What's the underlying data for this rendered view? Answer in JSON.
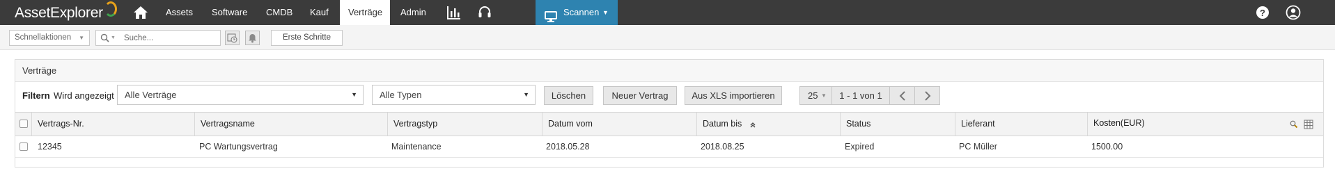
{
  "app": {
    "logo_text": "AssetExplorer"
  },
  "nav": {
    "items": [
      {
        "label": "Assets"
      },
      {
        "label": "Software"
      },
      {
        "label": "CMDB"
      },
      {
        "label": "Kauf"
      },
      {
        "label": "Verträge"
      },
      {
        "label": "Admin"
      }
    ],
    "active": "Verträge",
    "scan_label": "Scannen"
  },
  "quickbar": {
    "quick_actions_label": "Schnellaktionen",
    "search_placeholder": "Suche...",
    "first_steps_label": "Erste Schritte"
  },
  "panel": {
    "title": "Verträge",
    "filter_label": "Filtern",
    "shown_label": "Wird angezeigt",
    "view_select": "Alle Verträge",
    "type_select": "Alle Typen",
    "delete_label": "Löschen",
    "new_contract_label": "Neuer Vertrag",
    "import_label": "Aus XLS importieren",
    "page_size": "25",
    "page_range": "1 - 1 von 1"
  },
  "table": {
    "columns": [
      "Vertrags-Nr.",
      "Vertragsname",
      "Vertragstyp",
      "Datum vom",
      "Datum bis",
      "Status",
      "Lieferant",
      "Kosten(EUR)"
    ],
    "rows": [
      [
        "12345",
        "PC Wartungsvertrag",
        "Maintenance",
        "2018.05.28",
        "2018.08.25",
        "Expired",
        "PC Müller",
        "1500.00"
      ]
    ]
  },
  "colors": {
    "topbar": "#3b3b3b",
    "scan_accent": "#2e83b0",
    "logo_arc_orange": "#e8a21a",
    "logo_arc_green": "#3fa34d"
  }
}
